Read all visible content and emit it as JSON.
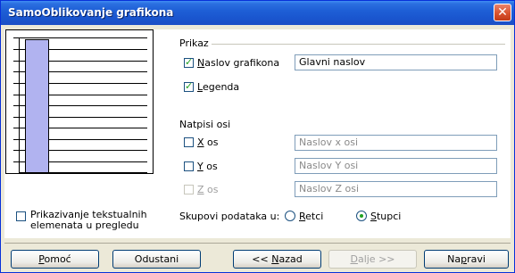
{
  "window": {
    "title": "SamoOblikovanje grafikona",
    "close_glyph": "✕"
  },
  "display": {
    "section_label": "Prikaz",
    "chart_title": {
      "checked": true,
      "label_hot": "N",
      "label_rest": "aslov grafikona",
      "value": "Glavni naslov"
    },
    "legend": {
      "checked": true,
      "label_hot": "L",
      "label_rest": "egenda"
    }
  },
  "axis_labels": {
    "section_label": "Natpisi osi",
    "x": {
      "checked": false,
      "label_hot": "X",
      "label_rest": " os",
      "placeholder": "Naslov x osi",
      "enabled": true
    },
    "y": {
      "checked": false,
      "label_hot": "Y",
      "label_rest": " os",
      "placeholder": "Naslov Y osi",
      "enabled": true
    },
    "z": {
      "checked": false,
      "label_hot": "Z",
      "label_rest": " os",
      "placeholder": "Naslov Z osi",
      "enabled": false
    }
  },
  "preview": {
    "show_text_label_line1": "Prikazivanje tekstualnih",
    "show_text_label_line2": "elemenata u pregledu",
    "bar_color": "#b1b3f0"
  },
  "data_series": {
    "label": "Skupovi podataka u:",
    "rows_hot": "R",
    "rows_rest": "etci",
    "cols_hot": "S",
    "cols_rest": "tupci",
    "selected": "columns"
  },
  "buttons": {
    "help_hot": "P",
    "help_rest": "omoć",
    "cancel": "Odustani",
    "back_pre": "<< ",
    "back_hot": "N",
    "back_rest": "azad",
    "next_hot": "D",
    "next_rest": "alje >>",
    "finish_pre": "Na",
    "finish_hot": "p",
    "finish_rest": "ravi"
  }
}
